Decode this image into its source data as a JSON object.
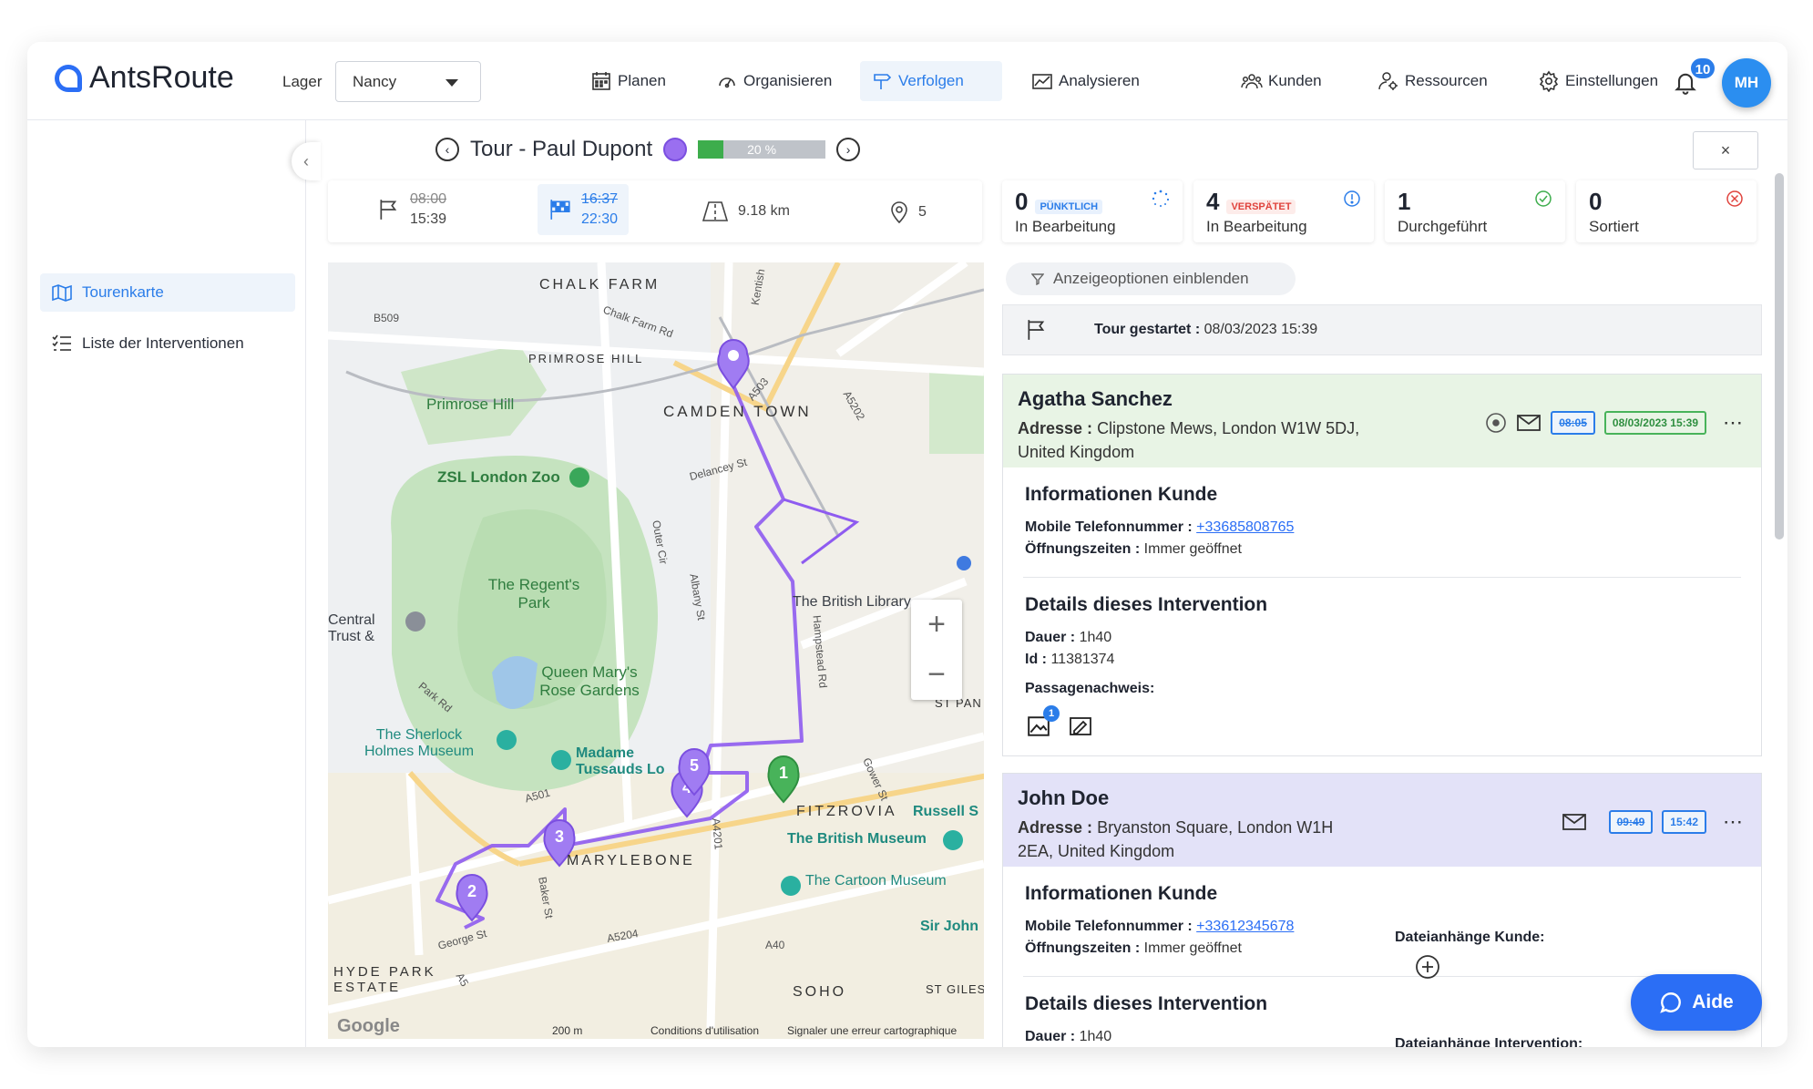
{
  "app": {
    "logo": "AntsRoute"
  },
  "header": {
    "lager_label": "Lager",
    "lager_value": "Nancy",
    "nav": [
      {
        "label": "Planen",
        "icon": "calendar-icon"
      },
      {
        "label": "Organisieren",
        "icon": "gauge-icon"
      },
      {
        "label": "Verfolgen",
        "icon": "signpost-icon"
      },
      {
        "label": "Analysieren",
        "icon": "chart-icon"
      },
      {
        "label": "Kunden",
        "icon": "customers-icon"
      },
      {
        "label": "Ressourcen",
        "icon": "resource-icon"
      },
      {
        "label": "Einstellungen",
        "icon": "gear-icon"
      }
    ],
    "notification_count": "10",
    "avatar_initials": "MH"
  },
  "sidebar": {
    "items": [
      {
        "label": "Tourenkarte",
        "icon": "map-icon"
      },
      {
        "label": "Liste der Interventionen",
        "icon": "list-icon"
      }
    ]
  },
  "tour": {
    "title": "Tour - Paul Dupont",
    "progress_label": "20 %",
    "progress": 0.2,
    "color": "#9a6ff0",
    "close": "×"
  },
  "stats": {
    "start_planned": "08:00",
    "start_actual": "15:39",
    "end_planned": "16:37",
    "end_actual": "22:30",
    "distance": "9.18 km",
    "stops": "5"
  },
  "kpis": [
    {
      "num": "0",
      "tag": "PÜNKTLICH",
      "label": "In Bearbeitung",
      "tag_color": "#2b7de9"
    },
    {
      "num": "4",
      "tag": "VERSPÄTET",
      "label": "In Bearbeitung",
      "tag_color": "#e0433d"
    },
    {
      "num": "1",
      "tag": "",
      "label": "Durchgeführt"
    },
    {
      "num": "0",
      "tag": "",
      "label": "Sortiert"
    }
  ],
  "filter": {
    "label": "Anzeigeoptionen einblenden"
  },
  "started": {
    "label": "Tour gestartet :",
    "value": "08/03/2023 15:39"
  },
  "interventions": [
    {
      "name": "Agatha Sanchez",
      "addr_label": "Adresse :",
      "addr": "Clipstone Mews, London W1W 5DJ, United Kingdom",
      "time_planned": "08:05",
      "time_actual": "08/03/2023 15:39",
      "info_title": "Informationen Kunde",
      "phone_label": "Mobile Telefonnummer :",
      "phone": "+33685808765",
      "hours_label": "Öffnungszeiten :",
      "hours": "Immer geöffnet",
      "details_title": "Details dieses Intervention",
      "duration_label": "Dauer :",
      "duration": "1h40",
      "id_label": "Id :",
      "id": "11381374",
      "proof_label": "Passagenachweis:",
      "proof_count": "1"
    },
    {
      "name": "John Doe",
      "addr_label": "Adresse :",
      "addr": "Bryanston Square, London W1H 2EA, United Kingdom",
      "time_planned": "09:49",
      "time_actual": "15:42",
      "info_title": "Informationen Kunde",
      "phone_label": "Mobile Telefonnummer :",
      "phone": "+33612345678",
      "hours_label": "Öffnungszeiten :",
      "hours": "Immer geöffnet",
      "attach_label": "Dateianhänge Kunde:",
      "details_title": "Details dieses Intervention",
      "duration_label": "Dauer :",
      "duration": "1h40",
      "attach2_label": "Dateianhänge Intervention:"
    }
  ],
  "map": {
    "labels": [
      "CHALK FARM",
      "PRIMROSE HILL",
      "Primrose Hill",
      "CAMDEN TOWN",
      "ZSL London Zoo",
      "The Regent's Park",
      "Queen Mary's Rose Gardens",
      "The British Library",
      "Central Trust &",
      "The Sherlock Holmes Museum",
      "Madame Tussauds Lo",
      "FITZROVIA",
      "Russell S",
      "The British Museum",
      "The Cartoon Museum",
      "MARYLEBONE",
      "Sir John",
      "HYDE PARK ESTATE",
      "SOHO",
      "ST GILES",
      "ST PAN"
    ],
    "roads": [
      "B509",
      "Chalk Farm Rd",
      "Kentish",
      "A503",
      "A5202",
      "Delancey St",
      "Outer Cir",
      "Albany St",
      "Hampstead Rd",
      "A501",
      "Park Rd",
      "Gower St",
      "A5204",
      "A40",
      "George St",
      "A5",
      "Baker St",
      "A4201"
    ],
    "markers": [
      "1",
      "2",
      "3",
      "4",
      "5"
    ],
    "scale": "200 m",
    "terms": "Conditions d'utilisation",
    "report": "Signaler une erreur cartographique",
    "google": "Google"
  },
  "help": {
    "label": "Aide"
  }
}
